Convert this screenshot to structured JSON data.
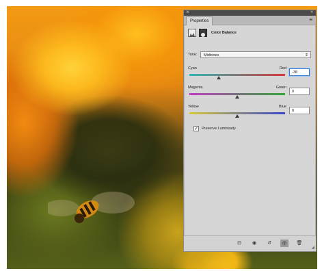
{
  "panel": {
    "close_glyph": "×",
    "collapse_glyph": "«",
    "tab_label": "Properties",
    "tab_menu_glyph": "≡",
    "adjustment_title": "Color Balance",
    "tone": {
      "label": "Tone:",
      "selected": "Midtones",
      "arrow": "⇕"
    },
    "sliders": [
      {
        "left_label": "Cyan",
        "right_label": "Red",
        "value": "-38",
        "fraction": 0.31,
        "active": true,
        "colors": [
          "#2fb7b6",
          "#d43a3a"
        ]
      },
      {
        "left_label": "Magenta",
        "right_label": "Green",
        "value": "0",
        "fraction": 0.5,
        "active": false,
        "colors": [
          "#c03cc0",
          "#33a63a"
        ]
      },
      {
        "left_label": "Yellow",
        "right_label": "Blue",
        "value": "0",
        "fraction": 0.5,
        "active": false,
        "colors": [
          "#d6c93a",
          "#3a47c8"
        ]
      }
    ],
    "preserve_luminosity": {
      "label": "Preserve Luminosity",
      "checked": true,
      "check_glyph": "✓"
    },
    "footer_buttons": [
      {
        "name": "clip-to-layer-icon",
        "glyph": "⊡"
      },
      {
        "name": "view-previous-icon",
        "glyph": "◉"
      },
      {
        "name": "reset-icon",
        "glyph": "↺"
      },
      {
        "name": "visibility-eye-icon",
        "glyph": "◎"
      },
      {
        "name": "trash-icon",
        "glyph": "🗑"
      }
    ]
  }
}
